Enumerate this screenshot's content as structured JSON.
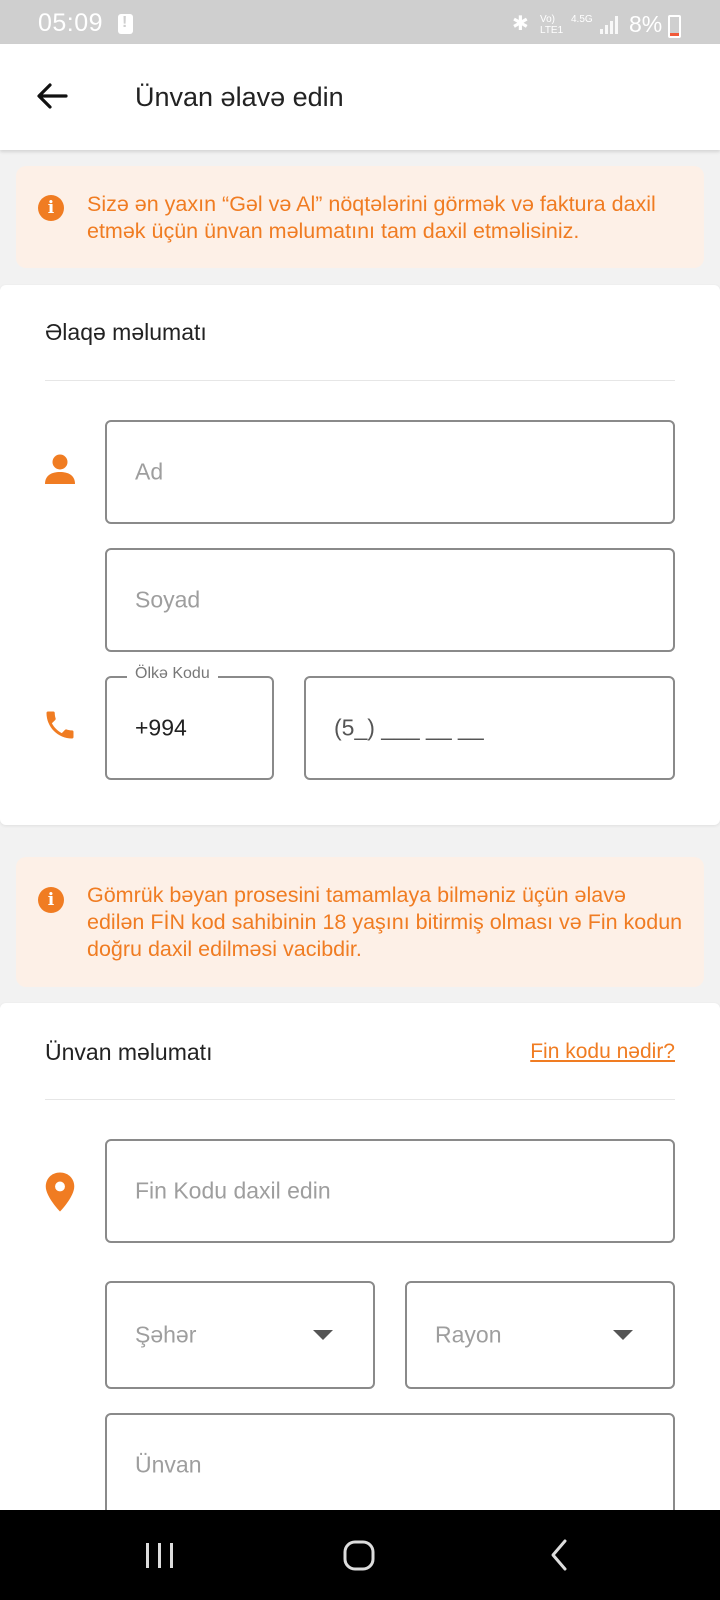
{
  "status_bar": {
    "time": "05:09",
    "network_top": "Vo)",
    "network_bottom": "LTE1",
    "network_type": "4.5G",
    "battery": "8%"
  },
  "header": {
    "title": "Ünvan əlavə edin",
    "back_icon": "arrow-left-icon"
  },
  "info_top": {
    "icon": "info-icon",
    "text": "Sizə ən yaxın “Gəl və Al” nöqtələrini görmək və faktura daxil etmək üçün ünvan məlumatını tam daxil etməlisiniz."
  },
  "contact": {
    "section_title": "Əlaqə məlumatı",
    "first_name_placeholder": "Ad",
    "last_name_placeholder": "Soyad",
    "country_code_label": "Ölkə Kodu",
    "country_code_value": "+994",
    "phone_mask": "(5_) ___ __ __"
  },
  "info_bottom": {
    "icon": "info-icon",
    "text": "Gömrük bəyan prosesini tamamlaya bilməniz üçün əlavə edilən FİN kod sahibinin 18 yaşını bitirmiş olması və Fin kodun doğru daxil edilməsi vacibdir."
  },
  "address": {
    "section_title": "Ünvan məlumatı",
    "fin_help_link": "Fin kodu nədir?",
    "fin_placeholder": "Fin Kodu daxil edin",
    "city_placeholder": "Şəhər",
    "district_placeholder": "Rayon",
    "address_placeholder": "Ünvan"
  },
  "colors": {
    "accent": "#f07c22",
    "info_background": "#fdf0e7",
    "status_bar": "#cfcfcf"
  }
}
